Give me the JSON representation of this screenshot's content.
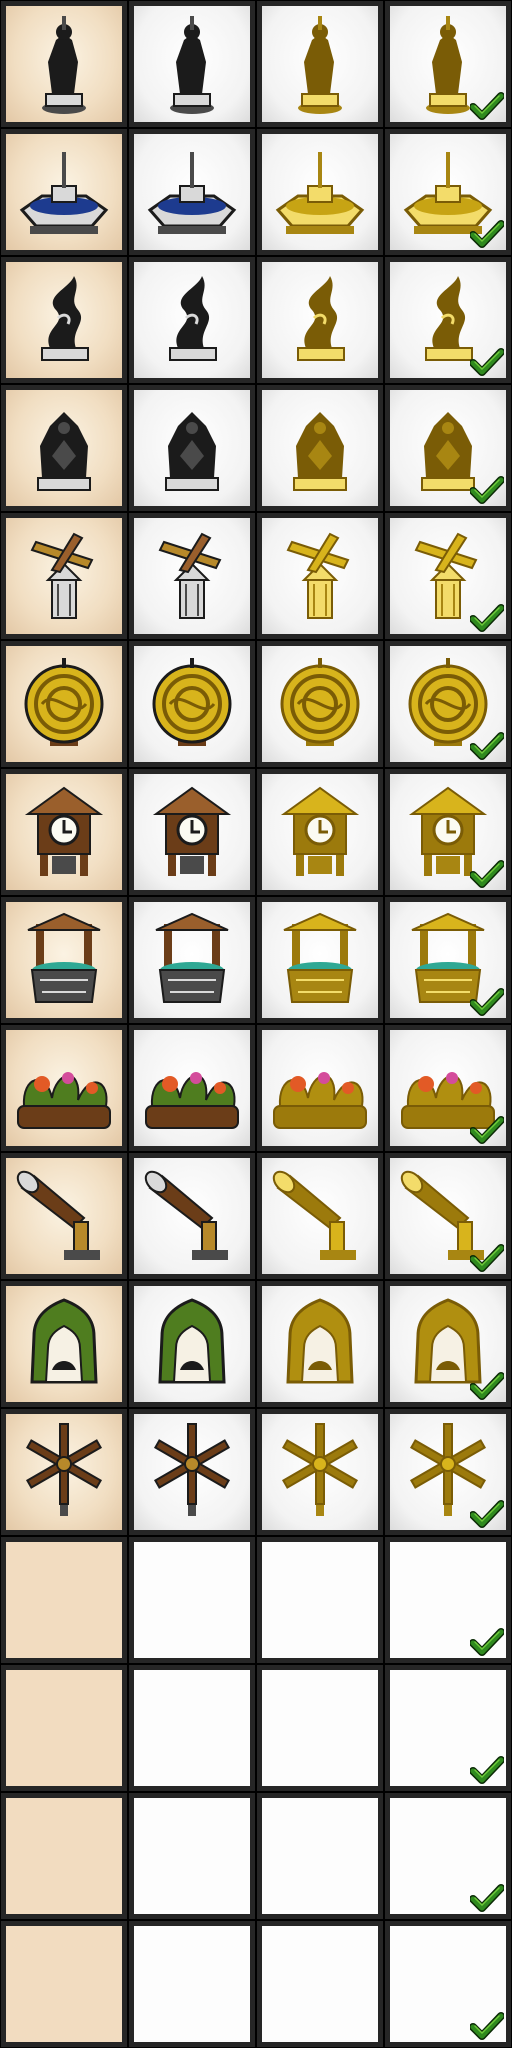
{
  "sheet": {
    "columns": [
      "parchment",
      "white",
      "white",
      "white"
    ],
    "column_variants": [
      "color",
      "color",
      "gold",
      "gold-check"
    ],
    "rows": [
      {
        "icon": "statue-icon"
      },
      {
        "icon": "fountain-icon"
      },
      {
        "icon": "abstract-sculpture-icon"
      },
      {
        "icon": "guardian-statue-icon"
      },
      {
        "icon": "weathervane-icon"
      },
      {
        "icon": "medallion-icon"
      },
      {
        "icon": "cuckoo-clock-icon"
      },
      {
        "icon": "wishing-well-icon"
      },
      {
        "icon": "flower-bed-icon"
      },
      {
        "icon": "telescope-icon"
      },
      {
        "icon": "shrine-icon"
      },
      {
        "icon": "windmill-icon"
      },
      {
        "icon": ""
      },
      {
        "icon": ""
      },
      {
        "icon": ""
      },
      {
        "icon": ""
      }
    ]
  },
  "colors": {
    "gold": "#d8b41c",
    "gold_dark": "#7a5c06",
    "check": "#2f8a1e",
    "check_light": "#6ecb3a"
  }
}
